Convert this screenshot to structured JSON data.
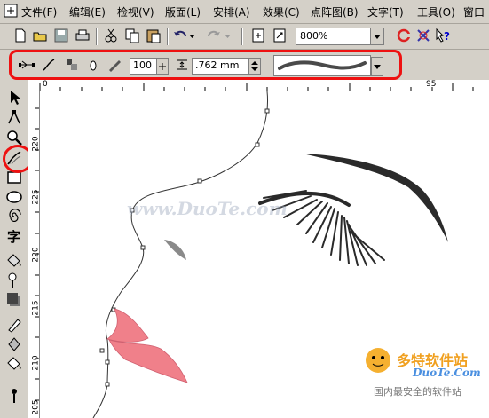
{
  "menu": {
    "items": [
      "文件(F)",
      "编辑(E)",
      "检视(V)",
      "版面(L)",
      "安排(A)",
      "效果(C)",
      "点阵图(B)",
      "文字(T)",
      "工具(O)",
      "窗口"
    ]
  },
  "toolbar": {
    "zoom_value": "800%"
  },
  "property_bar": {
    "smoothness_value": "100",
    "width_value": ".762 mm"
  },
  "rulers": {
    "top_labels": [
      "0",
      "95"
    ],
    "left_labels": [
      "220",
      "225",
      "220",
      "215",
      "210",
      "205"
    ]
  },
  "watermark": {
    "center_text": "www.DuoTe.com",
    "brand_cn": "多特软件站",
    "brand_en": "DuoTe.Com",
    "slogan": "国内最安全的软件站"
  },
  "colors": {
    "highlight_ring": "#e11111",
    "lips": "#f0808a",
    "lash": "#2a2a2a",
    "nostril": "#8a8a8a"
  },
  "icons": [
    "new-doc-icon",
    "open-icon",
    "save-icon",
    "print-icon",
    "cut-icon",
    "copy-icon",
    "paste-icon",
    "undo-icon",
    "redo-icon",
    "import-icon",
    "export-icon",
    "application-launcher-icon",
    "corel-online-icon",
    "whats-this-icon"
  ]
}
